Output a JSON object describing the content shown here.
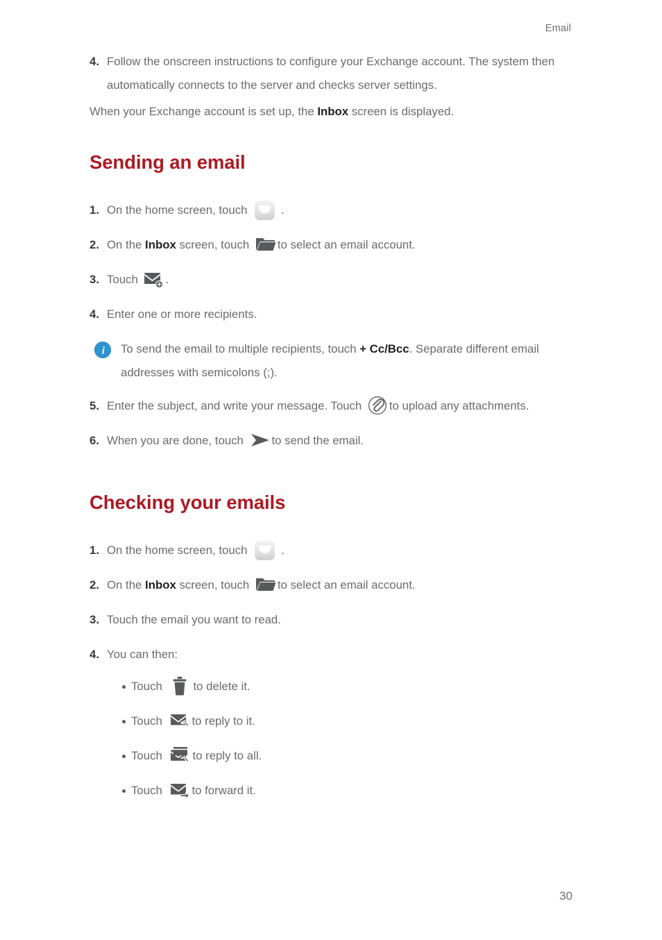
{
  "header": {
    "running_title": "Email"
  },
  "intro": {
    "step4": {
      "num": "4.",
      "text": "Follow the onscreen instructions to configure your Exchange account. The system then automatically connects to the server and checks server settings."
    },
    "paragraph_pre": "When your Exchange account is set up, the ",
    "paragraph_bold": "Inbox",
    "paragraph_post": " screen is displayed."
  },
  "sending": {
    "title": "Sending an email",
    "steps": [
      {
        "num": "1.",
        "pre": "On the home screen, touch ",
        "icon": "mail-app-icon",
        "post": "."
      },
      {
        "num": "2.",
        "pre": "On the ",
        "bold": "Inbox",
        "mid": " screen, touch ",
        "icon": "folder-icon",
        "post": "to select an email account."
      },
      {
        "num": "3.",
        "pre": "Touch ",
        "icon": "compose-icon",
        "post": "."
      },
      {
        "num": "4.",
        "pre": "Enter one or more recipients.",
        "icon": "",
        "post": ""
      }
    ],
    "note": {
      "icon": "info-icon",
      "pre": "To send the email to multiple recipients, touch ",
      "bold": "+ Cc/Bcc",
      "post": ". Separate different email addresses with semicolons (;)."
    },
    "steps_tail": [
      {
        "num": "5.",
        "pre": "Enter the subject, and write your message. Touch ",
        "icon": "attachment-clip-icon",
        "post": "to upload any attachments."
      },
      {
        "num": "6.",
        "pre": "When you are done, touch ",
        "icon": "send-icon",
        "post": "to send the email."
      }
    ]
  },
  "checking": {
    "title": "Checking your emails",
    "steps": [
      {
        "num": "1.",
        "pre": "On the home screen, touch ",
        "icon": "mail-app-icon",
        "post": "."
      },
      {
        "num": "2.",
        "pre": "On the ",
        "bold": "Inbox",
        "mid": " screen, touch ",
        "icon": "folder-icon",
        "post": "to select an email account."
      },
      {
        "num": "3.",
        "pre": "Touch the email you want to read.",
        "icon": "",
        "post": ""
      },
      {
        "num": "4.",
        "pre": "You can then:",
        "icon": "",
        "post": ""
      }
    ],
    "bullets": [
      {
        "pre": "Touch ",
        "icon": "trash-icon",
        "post": "to delete it."
      },
      {
        "pre": "Touch ",
        "icon": "reply-icon",
        "post": "to reply to it."
      },
      {
        "pre": "Touch ",
        "icon": "reply-all-icon",
        "post": "to reply to all."
      },
      {
        "pre": "Touch ",
        "icon": "forward-icon",
        "post": "to forward it."
      }
    ]
  },
  "footer": {
    "page_number": "30"
  },
  "colors": {
    "heading_red": "#ab1a23",
    "body_gray": "#6a6b6d",
    "bold_black": "#231f20",
    "info_blue": "#2e93ce",
    "icon_gray": "#58595b"
  }
}
